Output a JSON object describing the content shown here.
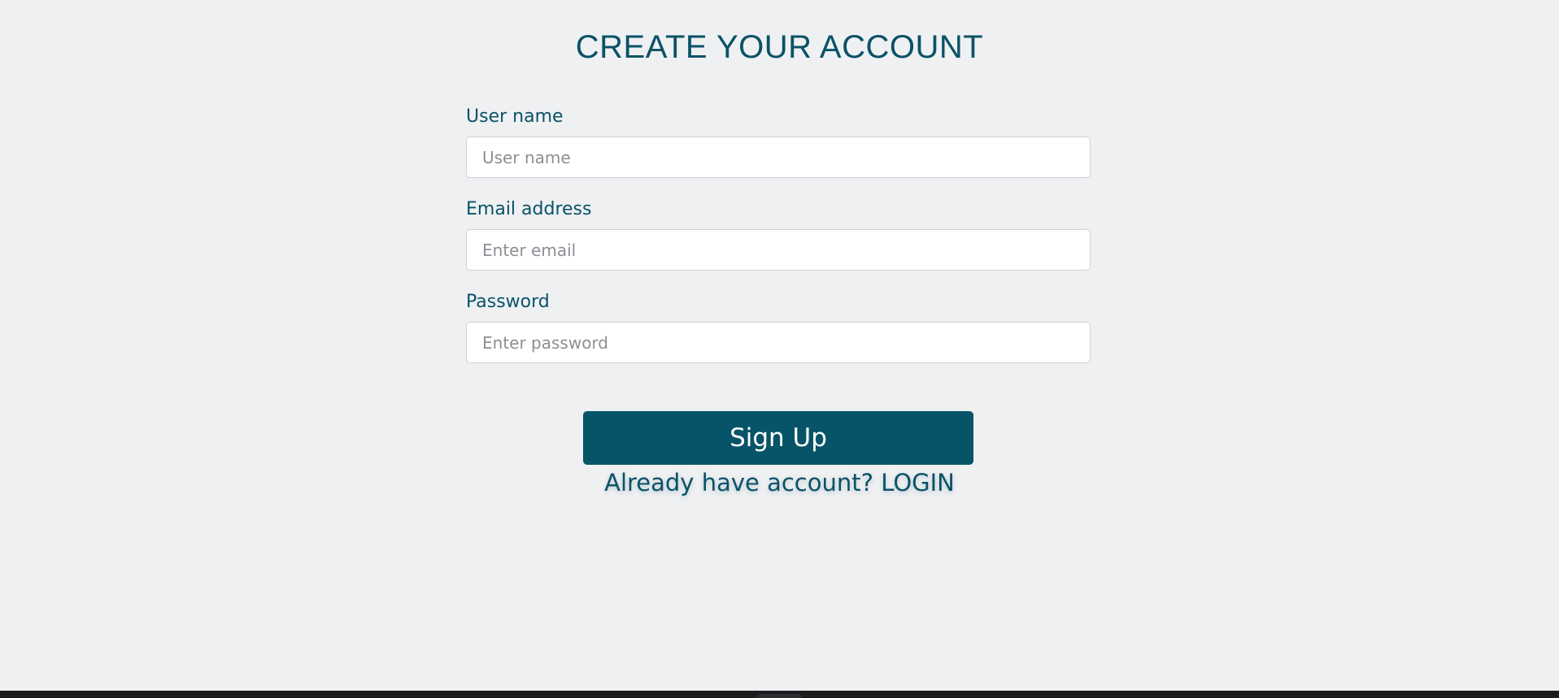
{
  "page": {
    "title": "CREATE YOUR ACCOUNT"
  },
  "form": {
    "username": {
      "label": "User name",
      "value": "",
      "placeholder": "User name"
    },
    "email": {
      "label": "Email address",
      "value": "",
      "placeholder": "Enter email"
    },
    "password": {
      "label": "Password",
      "value": "",
      "placeholder": "Enter password"
    },
    "submit_label": "Sign Up",
    "login_link_label": "Already have account? LOGIN"
  },
  "colors": {
    "background": "#eff0f2",
    "primary": "#075468",
    "text": "#0a5267",
    "input_border": "#cdd1d6",
    "taskbar": "#1d1b1e"
  }
}
